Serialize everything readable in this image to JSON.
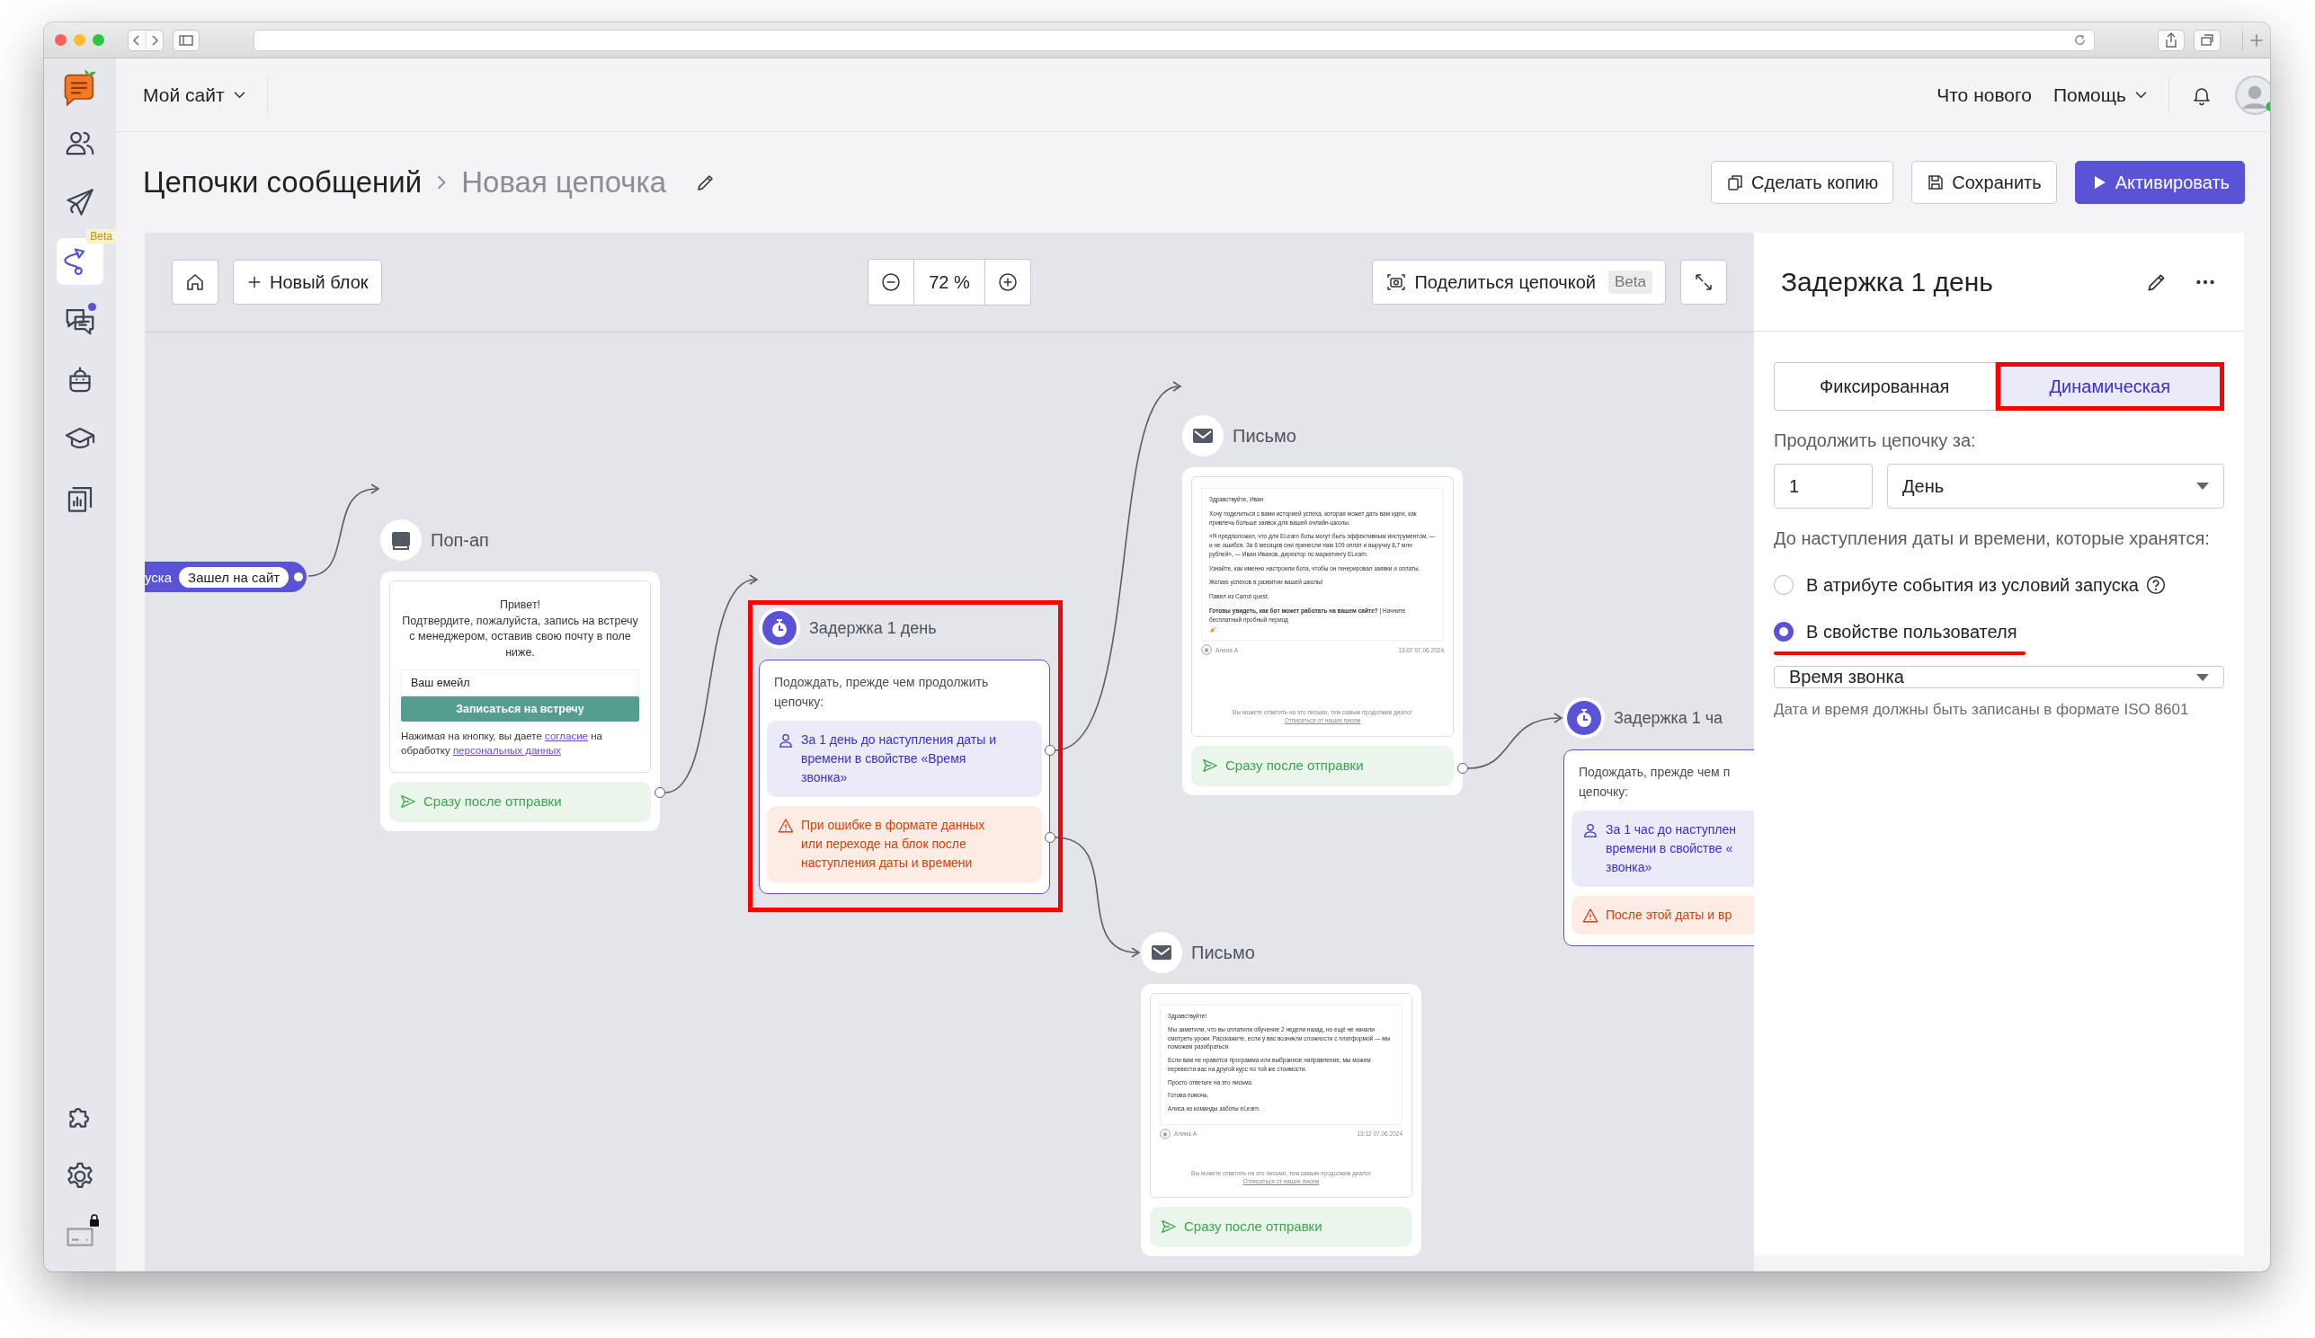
{
  "sidebar": {
    "top": [
      {
        "selected": false,
        "notification": false
      },
      {
        "selected": false,
        "notification": false
      },
      {
        "selected": true,
        "notification": false,
        "badge": "Beta"
      },
      {
        "selected": false,
        "notification": true
      },
      {
        "selected": false,
        "notification": false
      },
      {
        "selected": false,
        "notification": false
      },
      {
        "selected": false,
        "notification": false
      }
    ],
    "bottom": [
      {
        "selected": false,
        "locked": false
      },
      {
        "selected": false,
        "locked": false
      },
      {
        "selected": false,
        "locked": true
      }
    ]
  },
  "header": {
    "site": "Мой сайт",
    "links": [
      {
        "label": "Что нового",
        "dropdown": false
      },
      {
        "label": "Помощь",
        "dropdown": true
      }
    ],
    "avatar": {
      "online": true
    }
  },
  "page": {
    "breadcrumb": [
      "Цепочки сообщений",
      "Новая цепочка"
    ],
    "actions": [
      {
        "label": "Сделать копию",
        "kind": "copy"
      },
      {
        "label": "Сохранить",
        "kind": "save"
      },
      {
        "label": "Активировать",
        "kind": "activate"
      }
    ]
  },
  "toolbar": {
    "new_block": "Новый блок",
    "zoom": "72 %",
    "share": "Поделиться цепочкой",
    "share_badge": "Beta"
  },
  "canvas": {
    "trigger": {
      "label": "уска",
      "event": "Зашел на сайт"
    },
    "nodes": [
      {
        "kind": "popup",
        "title": "Поп-ап",
        "greeting": "Привет!",
        "text": "Подтвердите, пожалуйста, запись на встречу с менеджером, оставив свою почту в поле ниже.",
        "placeholder": "Ваш емейл",
        "button": "Записаться на встречу",
        "consent": [
          {
            "text": "Нажимая на кнопку, вы даете",
            "link": false
          },
          {
            "text": "согласие",
            "link": true
          },
          {
            "text": "на обработку",
            "link": false
          },
          {
            "text": "персональных данных",
            "link": true
          }
        ],
        "exits": [
          {
            "kind": "sent",
            "lines": [
              "Сразу после отправки"
            ]
          }
        ]
      },
      {
        "kind": "delay",
        "title": "Задержка 1 день",
        "highlighted": true,
        "intro": [
          "Подождать, прежде чем продолжить",
          "цепочку:"
        ],
        "exits": [
          {
            "kind": "property",
            "lines": [
              "За 1 день до наступления даты и",
              "времени в свойстве «Время",
              "звонка»"
            ]
          },
          {
            "kind": "error",
            "lines": [
              "При ошибке в формате данных",
              "или переходе на блок после",
              "наступления даты и времени"
            ]
          }
        ]
      },
      {
        "kind": "email",
        "title": "Письмо",
        "paragraphs": [
          "Здравствуйте, Иван",
          "Хочу поделиться с вами историей успеха, которая может дать вам идеи, как привлечь больше заявок для вашей онлайн-школы.",
          "«Я предположил, что для ELearn боты могут быть эффективным инструментом, — и не ошибся. За 6 месяцев они принесли нам 109 оплат и выручку 8,7 млн рублей», — Иван Иванов, директор по маркетингу ELearn.",
          "Узнайте, как именно настроили бота, чтобы он генерировал заявки и оплаты.",
          "Желаю успехов в развитии вашей школы!",
          "Павел из Carrot quest.",
          "**Готовы увидеть, как бот может работать на вашем сайте?** | Начните бесплатный пробный период"
        ],
        "sender": "Алена А",
        "time": "13:07 07.06.2024",
        "footer": [
          "Вы можете ответить на это письмо, тем самым продолжив диалог",
          "Отписаться от наших писем"
        ],
        "exits": [
          {
            "kind": "sent",
            "lines": [
              "Сразу после отправки"
            ]
          }
        ]
      },
      {
        "kind": "email",
        "title": "Письмо",
        "paragraphs": [
          "Здравствуйте!",
          "Мы заметили, что вы оплатили обучение 2 недели назад, но ещё не начали смотреть уроки. Расскажите, если у вас возникли сложности с платформой — мы поможем разобраться.",
          "Если вам не нравится программа или выбранное направление, мы можем перевести вас на другой курс по той же стоимости.",
          "Просто ответьте на это письмо.",
          "Готова помочь,",
          "Алиса из команды заботы eLearn."
        ],
        "sender": "Алина А",
        "time": "13:12 07.06.2024",
        "footer": [
          "Вы можете ответить на это письмо, тем самым продолжив диалог",
          "Отписаться от наших писем"
        ],
        "exits": [
          {
            "kind": "sent",
            "lines": [
              "Сразу после отправки"
            ]
          }
        ]
      },
      {
        "kind": "delay",
        "title": "Задержка 1 ча",
        "highlighted": false,
        "intro": [
          "Подождать, прежде чем п",
          "цепочку:"
        ],
        "exits": [
          {
            "kind": "property",
            "lines": [
              "За 1 час до наступлен",
              "времени в свойстве «",
              "звонка»"
            ]
          },
          {
            "kind": "error",
            "lines": [
              "После этой даты и вр"
            ]
          }
        ]
      }
    ]
  },
  "panel": {
    "title": "Задержка 1 день",
    "tabs": [
      {
        "label": "Фиксированная",
        "selected": false,
        "highlighted": false
      },
      {
        "label": "Динамическая",
        "selected": true,
        "highlighted": true
      }
    ],
    "continue_label": "Продолжить цепочку за:",
    "amount": "1",
    "unit": "День",
    "date_label": "До наступления даты и времени, которые хранятся:",
    "options": [
      {
        "label": "В атрибуте события из условий запуска",
        "selected": false,
        "help": true,
        "underlined": false
      },
      {
        "label": "В свойстве пользователя",
        "selected": true,
        "help": false,
        "underlined": true
      }
    ],
    "property": "Время звонка",
    "hint": "Дата и время должны быть записаны в формате ISO 8601"
  }
}
